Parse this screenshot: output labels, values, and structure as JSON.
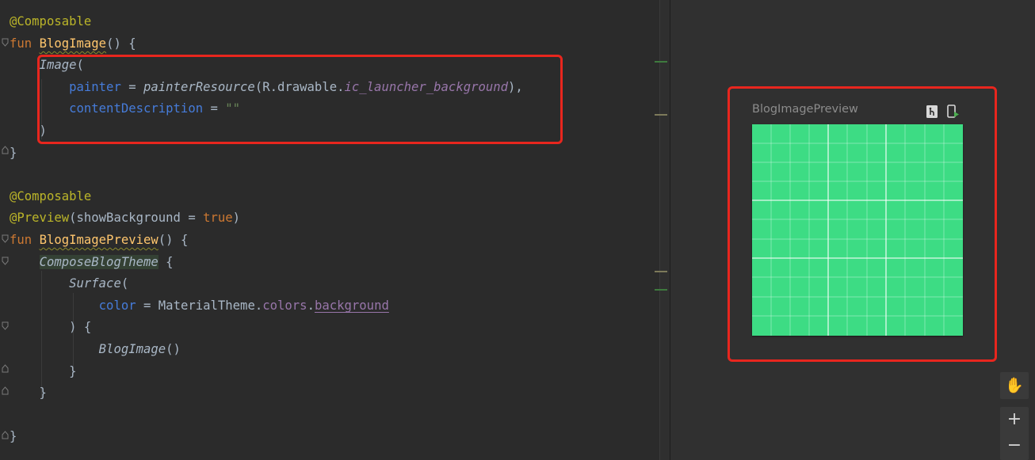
{
  "code": [
    [
      {
        "t": "@Composable",
        "c": "ann"
      }
    ],
    [
      {
        "t": "fun ",
        "c": "kw"
      },
      {
        "t": "BlogImage",
        "c": "fn"
      },
      {
        "t": "() {",
        "c": "plain"
      }
    ],
    [
      {
        "t": "    ",
        "c": "plain"
      },
      {
        "t": "Image",
        "c": "it"
      },
      {
        "t": "(",
        "c": "plain"
      }
    ],
    [
      {
        "t": "        ",
        "c": "plain"
      },
      {
        "t": "painter",
        "c": "named"
      },
      {
        "t": " = ",
        "c": "plain"
      },
      {
        "t": "painterResource",
        "c": "itfn"
      },
      {
        "t": "(R.drawable.",
        "c": "plain"
      },
      {
        "t": "ic_launcher_background",
        "c": "itprop"
      },
      {
        "t": "),",
        "c": "plain"
      }
    ],
    [
      {
        "t": "        ",
        "c": "plain"
      },
      {
        "t": "contentDescription",
        "c": "named"
      },
      {
        "t": " = ",
        "c": "plain"
      },
      {
        "t": "\"\"",
        "c": "str"
      }
    ],
    [
      {
        "t": "    )",
        "c": "plain"
      }
    ],
    [
      {
        "t": "}",
        "c": "plain"
      }
    ],
    [],
    [
      {
        "t": "@Composable",
        "c": "ann"
      }
    ],
    [
      {
        "t": "@Preview",
        "c": "ann"
      },
      {
        "t": "(showBackground = ",
        "c": "plain"
      },
      {
        "t": "true",
        "c": "kw"
      },
      {
        "t": ")",
        "c": "plain"
      }
    ],
    [
      {
        "t": "fun ",
        "c": "kw"
      },
      {
        "t": "BlogImagePreview",
        "c": "fn"
      },
      {
        "t": "() {",
        "c": "plain"
      }
    ],
    [
      {
        "t": "    ",
        "c": "plain"
      },
      {
        "t": "ComposeBlogTheme",
        "c": "theme"
      },
      {
        "t": " {",
        "c": "plain"
      }
    ],
    [
      {
        "t": "        ",
        "c": "plain"
      },
      {
        "t": "Surface",
        "c": "it"
      },
      {
        "t": "(",
        "c": "plain"
      }
    ],
    [
      {
        "t": "            ",
        "c": "plain"
      },
      {
        "t": "color",
        "c": "named"
      },
      {
        "t": " = MaterialTheme.",
        "c": "plain"
      },
      {
        "t": "colors",
        "c": "prop"
      },
      {
        "t": ".",
        "c": "plain"
      },
      {
        "t": "background",
        "c": "propul"
      }
    ],
    [
      {
        "t": "        ) {",
        "c": "plain"
      }
    ],
    [
      {
        "t": "            ",
        "c": "plain"
      },
      {
        "t": "BlogImage",
        "c": "it"
      },
      {
        "t": "()",
        "c": "plain"
      }
    ],
    [
      {
        "t": "        }",
        "c": "plain"
      }
    ],
    [
      {
        "t": "    }",
        "c": "plain"
      }
    ],
    [],
    [
      {
        "t": "}",
        "c": "plain"
      }
    ]
  ],
  "preview": {
    "title": "BlogImagePreview",
    "icons": [
      "interactive-mode-icon",
      "deploy-preview-icon"
    ]
  },
  "toolbar": {
    "pan": "✋",
    "zoom_in": "+",
    "zoom_out": "−"
  },
  "colors": {
    "editor_bg": "#2b2b2b",
    "highlight": "#e8261e",
    "image_bg": "#3ddc84"
  }
}
